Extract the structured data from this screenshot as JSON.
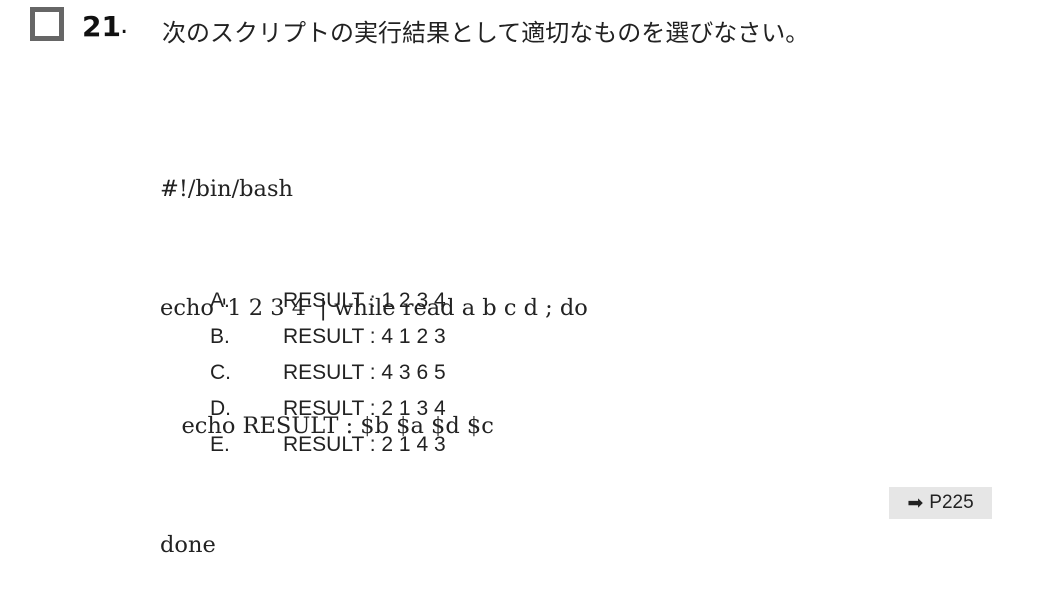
{
  "question": {
    "number": "21",
    "number_suffix": ".",
    "text": "次のスクリプトの実行結果として適切なものを選びなさい。"
  },
  "code_lines": [
    "#!/bin/bash",
    "echo '1 2 3 4' | while read a b c d ; do",
    "   echo RESULT : $b $a $d $c",
    "done"
  ],
  "options": [
    {
      "letter": "A.",
      "text": "RESULT : 1 2 3 4"
    },
    {
      "letter": "B.",
      "text": "RESULT : 4 1 2 3"
    },
    {
      "letter": "C.",
      "text": "RESULT : 4 3 6 5"
    },
    {
      "letter": "D.",
      "text": "RESULT : 2 1 3 4"
    },
    {
      "letter": "E.",
      "text": "RESULT : 2 1 4 3"
    }
  ],
  "reference": {
    "arrow_icon": "arrow-right-icon",
    "page": "P225"
  }
}
